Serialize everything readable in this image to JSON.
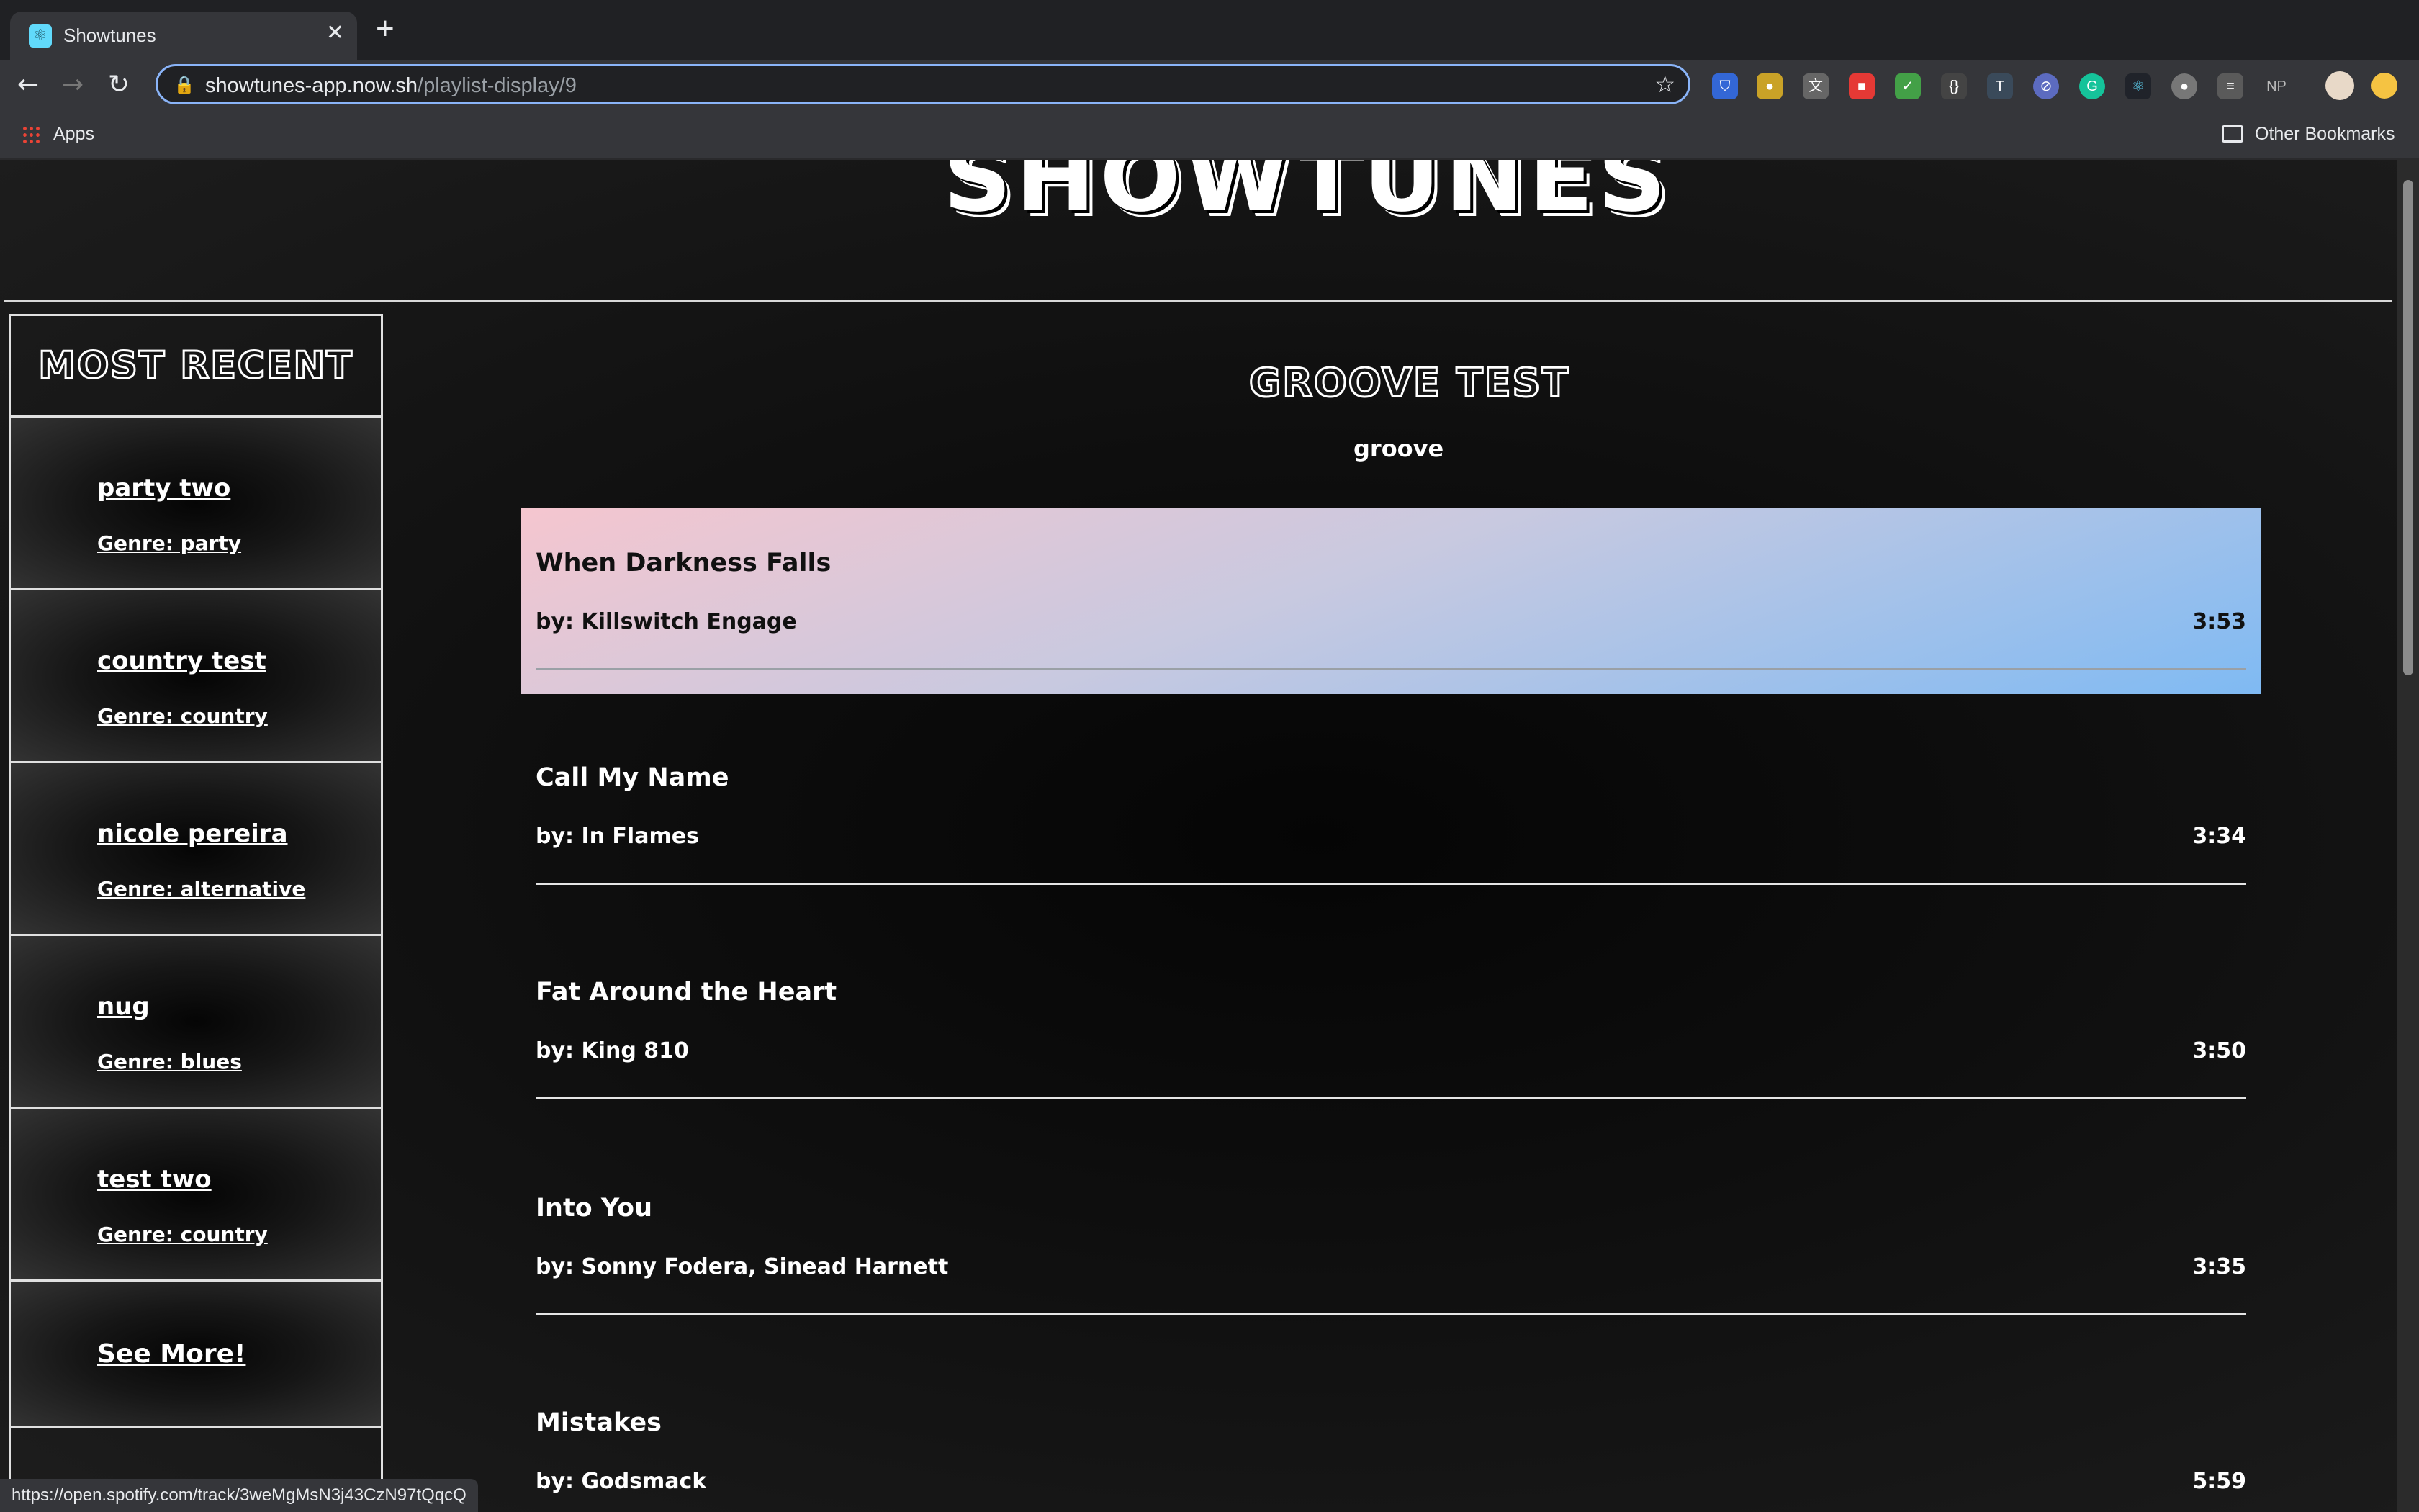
{
  "browser": {
    "tab_title": "Showtunes",
    "tab_close": "✕",
    "new_tab": "+",
    "url_host": "showtunes-app.now.sh",
    "url_path": "/playlist-display/9",
    "bookmarks_apps": "Apps",
    "bookmarks_other": "Other Bookmarks",
    "extensions_np": "NP",
    "status_url": "https://open.spotify.com/track/3weMgMsN3j43CzN97tQqcQ"
  },
  "page": {
    "logo": "SHOWTUNES",
    "sidebar": {
      "heading": "Most Recent",
      "items": [
        {
          "name": "party two",
          "genre": "Genre: party"
        },
        {
          "name": "country test",
          "genre": "Genre: country"
        },
        {
          "name": "nicole pereira",
          "genre": "Genre: alternative"
        },
        {
          "name": "nug",
          "genre": "Genre: blues"
        },
        {
          "name": "test two",
          "genre": "Genre: country"
        }
      ],
      "see_more": "See More!"
    },
    "playlist": {
      "title": "Groove Test",
      "genre": "groove",
      "tracks": [
        {
          "name": "When Darkness Falls",
          "artist": "by: Killswitch Engage",
          "duration": "3:53",
          "active": true
        },
        {
          "name": "Call My Name",
          "artist": "by: In Flames",
          "duration": "3:34"
        },
        {
          "name": "Fat Around the Heart",
          "artist": "by: King 810",
          "duration": "3:50"
        },
        {
          "name": "Into You",
          "artist": "by: Sonny Fodera, Sinead Harnett",
          "duration": "3:35"
        },
        {
          "name": "Mistakes",
          "artist": "by: Godsmack",
          "duration": "5:59"
        }
      ]
    }
  },
  "colors": {
    "active_gradient_start": "#f5c6cf",
    "active_gradient_end": "#7fbaf3",
    "page_background": "#161616"
  }
}
